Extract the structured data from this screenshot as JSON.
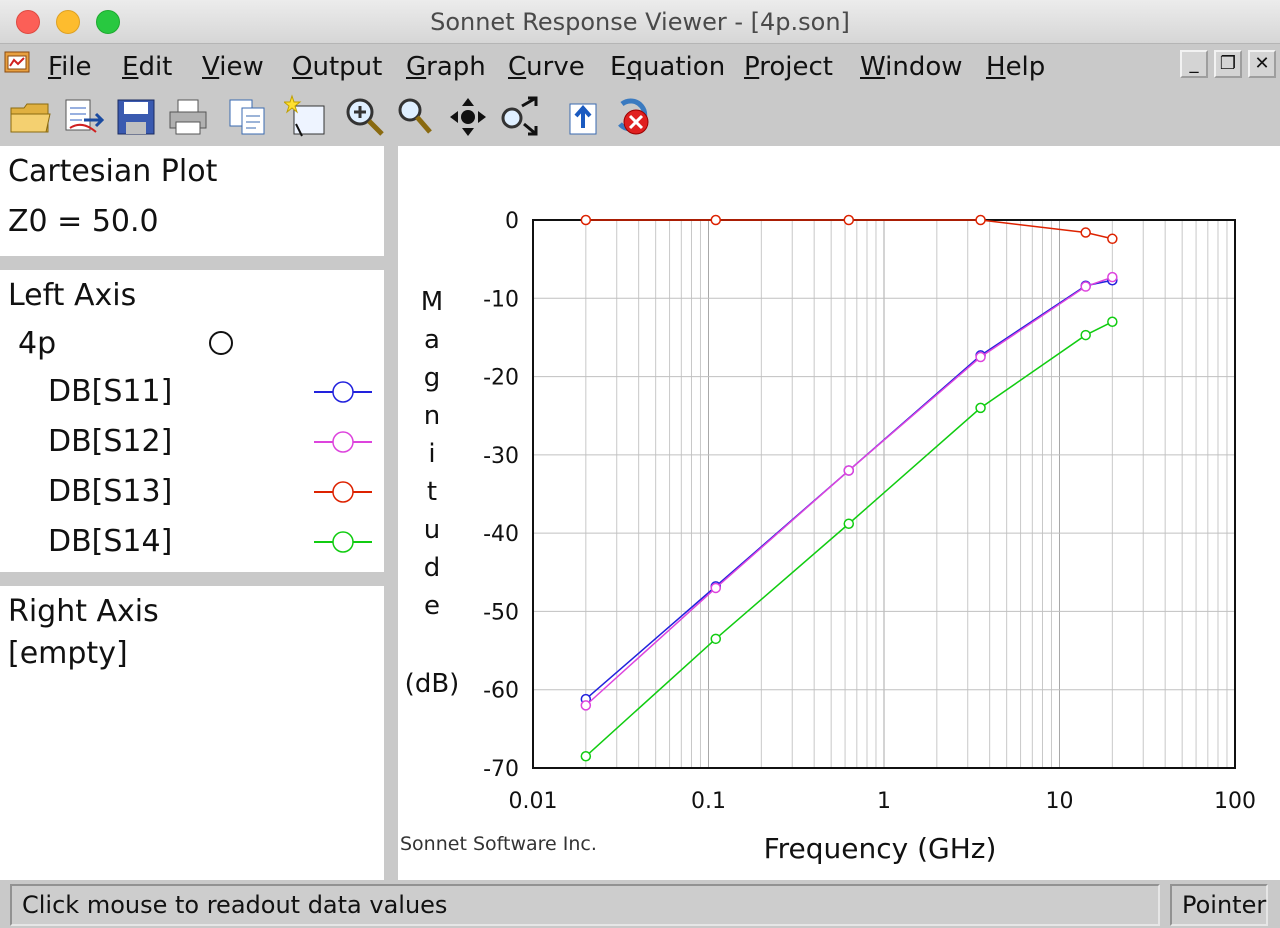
{
  "window": {
    "title": "Sonnet Response Viewer - [4p.son]"
  },
  "menu": [
    {
      "label": "File",
      "u": "F",
      "rest": "ile"
    },
    {
      "label": "Edit",
      "u": "E",
      "rest": "dit"
    },
    {
      "label": "View",
      "u": "V",
      "rest": "iew"
    },
    {
      "label": "Output",
      "u": "O",
      "rest": "utput"
    },
    {
      "label": "Graph",
      "u": "G",
      "rest": "raph"
    },
    {
      "label": "Curve",
      "u": "C",
      "rest": "urve"
    },
    {
      "label": "Equation",
      "pre": "E",
      "u": "q",
      "rest": "uation"
    },
    {
      "label": "Project",
      "u": "P",
      "rest": "roject"
    },
    {
      "label": "Window",
      "u": "W",
      "rest": "indow"
    },
    {
      "label": "Help",
      "u": "H",
      "rest": "elp"
    }
  ],
  "window_controls": [
    "minimize",
    "restore",
    "close"
  ],
  "toolbar": [
    "open-folder-icon",
    "import-data-icon",
    "save-icon",
    "print-icon",
    "copy-icon",
    "new-graph-icon",
    "zoom-in-icon",
    "zoom-out-icon",
    "pan-icon",
    "rescale-icon",
    "update-icon",
    "stop-icon"
  ],
  "sidebar": {
    "plot_type": "Cartesian Plot",
    "z0": "Z0 = 50.0",
    "left_axis_title": "Left Axis",
    "project_name": "4p",
    "series": [
      {
        "label": "DB[S11]",
        "color": "#2222dd"
      },
      {
        "label": "DB[S12]",
        "color": "#dd44dd"
      },
      {
        "label": "DB[S13]",
        "color": "#dd2200"
      },
      {
        "label": "DB[S14]",
        "color": "#11cc11"
      }
    ],
    "right_axis_title": "Right Axis",
    "right_axis_value": "[empty]"
  },
  "chart_data": {
    "type": "line",
    "xscale": "log",
    "xlim": [
      0.01,
      100
    ],
    "ylim": [
      -70,
      0
    ],
    "xlabel": "Frequency (GHz)",
    "ylabel_letters": [
      "M",
      "a",
      "g",
      "n",
      "i",
      "t",
      "u",
      "d",
      "e"
    ],
    "ylabel_unit": "(dB)",
    "xticks": [
      "0.01",
      "0.1",
      "1",
      "10",
      "100"
    ],
    "yticks": [
      "0",
      "-10",
      "-20",
      "-30",
      "-40",
      "-50",
      "-60",
      "-70"
    ],
    "grid": true,
    "credit": "Sonnet Software Inc.",
    "x": [
      0.02,
      0.11,
      0.63,
      3.55,
      14.1,
      20
    ],
    "series": [
      {
        "name": "DB[S11]",
        "color": "#2222dd",
        "values": [
          -61.2,
          -46.8,
          -32.0,
          -17.3,
          -8.4,
          -7.7
        ]
      },
      {
        "name": "DB[S12]",
        "color": "#dd44dd",
        "values": [
          -62.0,
          -47.0,
          -32.0,
          -17.5,
          -8.5,
          -7.3
        ]
      },
      {
        "name": "DB[S13]",
        "color": "#dd2200",
        "values": [
          0.0,
          0.0,
          0.0,
          0.0,
          -1.6,
          -2.4
        ]
      },
      {
        "name": "DB[S14]",
        "color": "#11cc11",
        "values": [
          -68.5,
          -53.5,
          -38.8,
          -24.0,
          -14.7,
          -13.0
        ]
      }
    ]
  },
  "status": {
    "message": "Click mouse to readout data values",
    "mode": "Pointer"
  }
}
